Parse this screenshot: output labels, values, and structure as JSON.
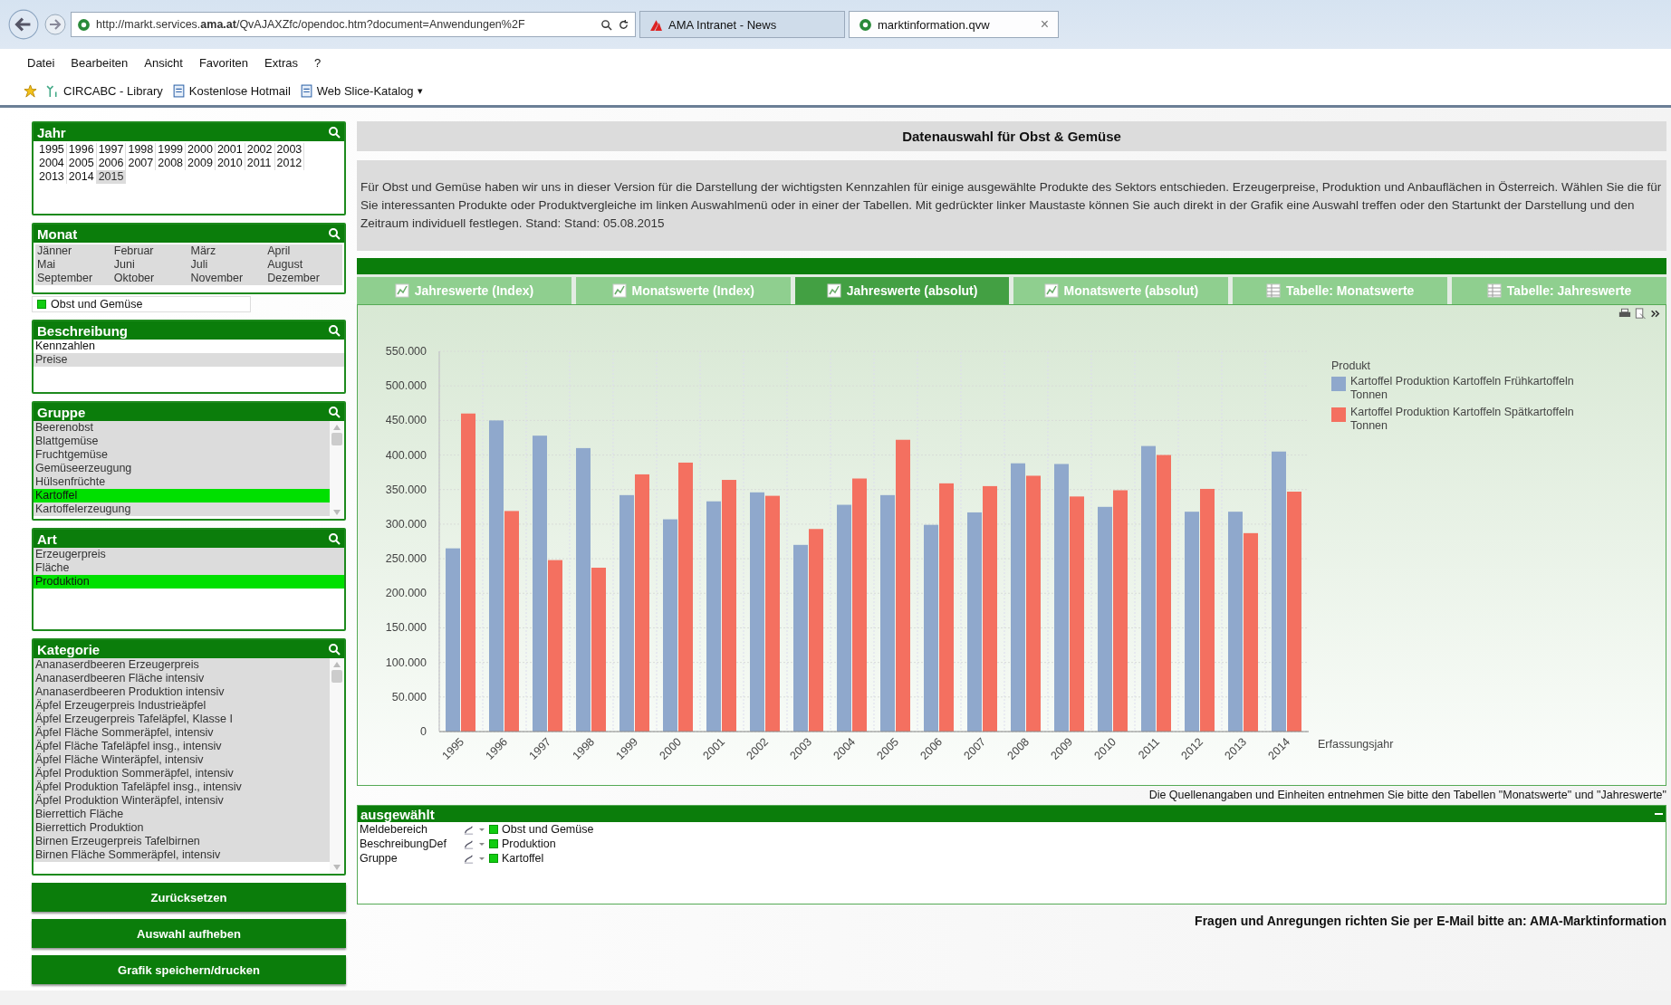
{
  "browser": {
    "address": "http://markt.services.**ama.at**/QvAJAXZfc/opendoc.htm?document=Anwendungen%2F",
    "tabs": [
      {
        "label": "AMA Intranet - News",
        "selected": false,
        "kind": "news"
      },
      {
        "label": "marktinformation.qvw",
        "selected": true,
        "kind": "qlik",
        "close": "×"
      }
    ],
    "menu": [
      "Datei",
      "Bearbeiten",
      "Ansicht",
      "Favoriten",
      "Extras",
      "?"
    ],
    "favorites": [
      {
        "label": "CIRCABC - Library",
        "kind": "site"
      },
      {
        "label": "Kostenlose Hotmail",
        "kind": "page"
      },
      {
        "label": "Web Slice-Katalog",
        "kind": "page",
        "caret": "▾"
      }
    ]
  },
  "sidebar": {
    "jahr": {
      "title": "Jahr",
      "items": [
        {
          "label": "1995",
          "selected": false,
          "excluded": false
        },
        {
          "label": "1996",
          "selected": false,
          "excluded": false
        },
        {
          "label": "1997",
          "selected": false,
          "excluded": false
        },
        {
          "label": "1998",
          "selected": false,
          "excluded": false
        },
        {
          "label": "1999",
          "selected": false,
          "excluded": false
        },
        {
          "label": "2000",
          "selected": false,
          "excluded": false
        },
        {
          "label": "2001",
          "selected": false,
          "excluded": false
        },
        {
          "label": "2002",
          "selected": false,
          "excluded": false
        },
        {
          "label": "2003",
          "selected": false,
          "excluded": false
        },
        {
          "label": "2004",
          "selected": false,
          "excluded": false
        },
        {
          "label": "2005",
          "selected": false,
          "excluded": false
        },
        {
          "label": "2006",
          "selected": false,
          "excluded": false
        },
        {
          "label": "2007",
          "selected": false,
          "excluded": false
        },
        {
          "label": "2008",
          "selected": false,
          "excluded": false
        },
        {
          "label": "2009",
          "selected": false,
          "excluded": false
        },
        {
          "label": "2010",
          "selected": false,
          "excluded": false
        },
        {
          "label": "2011",
          "selected": false,
          "excluded": false
        },
        {
          "label": "2012",
          "selected": false,
          "excluded": false
        },
        {
          "label": "2013",
          "selected": false,
          "excluded": false
        },
        {
          "label": "2014",
          "selected": false,
          "excluded": false
        },
        {
          "label": "2015",
          "selected": false,
          "excluded": true
        }
      ]
    },
    "monat": {
      "title": "Monat",
      "items": [
        {
          "label": "Jänner",
          "selected": false,
          "excluded": true
        },
        {
          "label": "Februar",
          "selected": false,
          "excluded": true
        },
        {
          "label": "März",
          "selected": false,
          "excluded": true
        },
        {
          "label": "April",
          "selected": false,
          "excluded": true
        },
        {
          "label": "Mai",
          "selected": false,
          "excluded": true
        },
        {
          "label": "Juni",
          "selected": false,
          "excluded": true
        },
        {
          "label": "Juli",
          "selected": false,
          "excluded": true
        },
        {
          "label": "August",
          "selected": false,
          "excluded": true
        },
        {
          "label": "September",
          "selected": false,
          "excluded": true
        },
        {
          "label": "Oktober",
          "selected": false,
          "excluded": true
        },
        {
          "label": "November",
          "selected": false,
          "excluded": true
        },
        {
          "label": "Dezember",
          "selected": false,
          "excluded": true
        }
      ]
    },
    "current": "Obst und Gemüse",
    "lists": [
      {
        "title": "Beschreibung",
        "scrollbar": false,
        "items": [
          {
            "label": "Kennzahlen",
            "selected": false,
            "excluded": false
          },
          {
            "label": "Preise",
            "selected": false,
            "excluded": true
          }
        ]
      },
      {
        "title": "Gruppe",
        "scrollbar": true,
        "items": [
          {
            "label": "Beerenobst",
            "selected": false,
            "excluded": true
          },
          {
            "label": "Blattgemüse",
            "selected": false,
            "excluded": true
          },
          {
            "label": "Fruchtgemüse",
            "selected": false,
            "excluded": true
          },
          {
            "label": "Gemüseerzeugung",
            "selected": false,
            "excluded": true
          },
          {
            "label": "Hülsenfrüchte",
            "selected": false,
            "excluded": true
          },
          {
            "label": "Kartoffel",
            "selected": true,
            "excluded": false
          },
          {
            "label": "Kartoffelerzeugung",
            "selected": false,
            "excluded": true
          }
        ]
      },
      {
        "title": "Art",
        "scrollbar": false,
        "items": [
          {
            "label": "Erzeugerpreis",
            "selected": false,
            "excluded": true
          },
          {
            "label": "Fläche",
            "selected": false,
            "excluded": true
          },
          {
            "label": "Produktion",
            "selected": true,
            "excluded": false
          }
        ]
      },
      {
        "title": "Kategorie",
        "scrollbar": true,
        "items": [
          {
            "label": "Ananaserdbeeren Erzeugerpreis",
            "selected": false,
            "excluded": true
          },
          {
            "label": "Ananaserdbeeren Fläche intensiv",
            "selected": false,
            "excluded": true
          },
          {
            "label": "Ananaserdbeeren Produktion intensiv",
            "selected": false,
            "excluded": true
          },
          {
            "label": "Äpfel Erzeugerpreis Industrieäpfel",
            "selected": false,
            "excluded": true
          },
          {
            "label": "Äpfel Erzeugerpreis Tafeläpfel, Klasse I",
            "selected": false,
            "excluded": true
          },
          {
            "label": "Äpfel Fläche Sommeräpfel, intensiv",
            "selected": false,
            "excluded": true
          },
          {
            "label": "Äpfel Fläche Tafeläpfel insg., intensiv",
            "selected": false,
            "excluded": true
          },
          {
            "label": "Äpfel Fläche Winteräpfel, intensiv",
            "selected": false,
            "excluded": true
          },
          {
            "label": "Äpfel Produktion Sommeräpfel, intensiv",
            "selected": false,
            "excluded": true
          },
          {
            "label": "Äpfel Produktion Tafeläpfel insg., intensiv",
            "selected": false,
            "excluded": true
          },
          {
            "label": "Äpfel Produktion Winteräpfel, intensiv",
            "selected": false,
            "excluded": true
          },
          {
            "label": "Bierrettich Fläche",
            "selected": false,
            "excluded": true
          },
          {
            "label": "Bierrettich Produktion",
            "selected": false,
            "excluded": true
          },
          {
            "label": "Birnen Erzeugerpreis Tafelbirnen",
            "selected": false,
            "excluded": true
          },
          {
            "label": "Birnen Fläche Sommeräpfel, intensiv",
            "selected": false,
            "excluded": true
          }
        ]
      }
    ],
    "buttons": [
      "Zurücksetzen",
      "Auswahl aufheben",
      "Grafik speichern/drucken"
    ]
  },
  "main": {
    "title": "Datenauswahl für Obst & Gemüse",
    "description": "Für Obst und Gemüse haben wir uns in dieser Version für die Darstellung der wichtigsten Kennzahlen für einige ausgewählte Produkte des Sektors entschieden. Erzeugerpreise, Produktion und Anbauflächen in Österreich. Wählen Sie die für Sie interessanten Produkte oder Produktvergleiche im linken Auswahlmenü oder in einer der Tabellen. Mit gedrückter linker Maustaste können Sie auch direkt in der Grafik eine Auswahl treffen oder den Startunkt der Darstellung und den Zeitraum individuell festlegen. Stand: Stand: 05.08.2015",
    "tabs": [
      {
        "label": "Jahreswerte (Index)",
        "kind": "chart",
        "selected": false
      },
      {
        "label": "Monatswerte (Index)",
        "kind": "chart",
        "selected": false
      },
      {
        "label": "Jahreswerte (absolut)",
        "kind": "chart",
        "selected": true
      },
      {
        "label": "Monatswerte (absolut)",
        "kind": "chart",
        "selected": false
      },
      {
        "label": "Tabelle: Monatswerte",
        "kind": "table",
        "selected": false
      },
      {
        "label": "Tabelle: Jahreswerte",
        "kind": "table",
        "selected": false
      }
    ],
    "chart_data": {
      "type": "bar",
      "xlabel": "Erfassungsjahr",
      "legend": {
        "title": "Produkt"
      },
      "grid": true,
      "categories": [
        "1995",
        "1996",
        "1997",
        "1998",
        "1999",
        "2000",
        "2001",
        "2002",
        "2003",
        "2004",
        "2005",
        "2006",
        "2007",
        "2008",
        "2009",
        "2010",
        "2011",
        "2012",
        "2013",
        "2014"
      ],
      "series": [
        {
          "name": "Kartoffel Produktion Kartoffeln Frühkartoffeln Tonnen",
          "color": "#8fa8cc",
          "values": [
            265000,
            450000,
            428000,
            410000,
            342000,
            307000,
            333000,
            346000,
            270000,
            328000,
            342000,
            299000,
            317000,
            388000,
            387000,
            325000,
            413000,
            318000,
            318000,
            405000
          ]
        },
        {
          "name": "Kartoffel Produktion Kartoffeln Spätkartoffeln Tonnen",
          "color": "#f47060",
          "values": [
            460000,
            319000,
            248000,
            237000,
            372000,
            389000,
            364000,
            341000,
            293000,
            366000,
            422000,
            359000,
            355000,
            370000,
            340000,
            349000,
            400000,
            351000,
            287000,
            347000
          ]
        }
      ],
      "ylim": [
        0,
        550000
      ],
      "yticks": [
        {
          "value": 0,
          "label": "0"
        },
        {
          "value": 50000,
          "label": "50.000"
        },
        {
          "value": 100000,
          "label": "100.000"
        },
        {
          "value": 150000,
          "label": "150.000"
        },
        {
          "value": 200000,
          "label": "200.000"
        },
        {
          "value": 250000,
          "label": "250.000"
        },
        {
          "value": 300000,
          "label": "300.000"
        },
        {
          "value": 350000,
          "label": "350.000"
        },
        {
          "value": 400000,
          "label": "400.000"
        },
        {
          "value": 450000,
          "label": "450.000"
        },
        {
          "value": 500000,
          "label": "500.000"
        },
        {
          "value": 550000,
          "label": "550.000"
        }
      ]
    },
    "source_note": "Die Quellenangaben und Einheiten entnehmen Sie bitte den Tabellen \"Monatswerte\" und \"Jahreswerte\"",
    "current_selections": {
      "title": "ausgewählt",
      "rows": [
        {
          "field": "Meldebereich",
          "value": "Obst und Gemüse"
        },
        {
          "field": "BeschreibungDef",
          "value": "Produktion"
        },
        {
          "field": "Gruppe",
          "value": "Kartoffel"
        }
      ]
    },
    "footer": "Fragen und Anregungen richten Sie per E-Mail bitte an: AMA-Marktinformation"
  }
}
